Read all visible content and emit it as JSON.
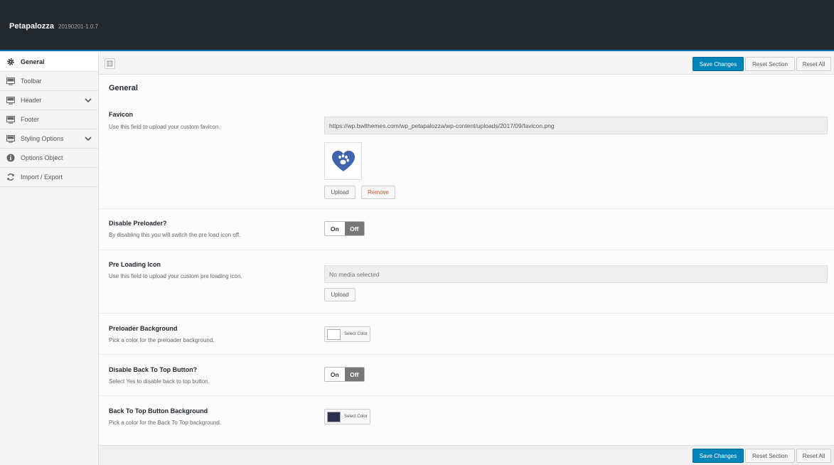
{
  "header": {
    "title": "Petapalozza",
    "version": "20190201-1.0.7"
  },
  "sidebar": {
    "items": [
      {
        "label": "General",
        "icon": "gear-icon"
      },
      {
        "label": "Toolbar",
        "icon": "monitor-icon"
      },
      {
        "label": "Header",
        "icon": "monitor-icon"
      },
      {
        "label": "Footer",
        "icon": "monitor-icon"
      },
      {
        "label": "Styling Options",
        "icon": "monitor-icon"
      },
      {
        "label": "Options Object",
        "icon": "info-icon"
      },
      {
        "label": "Import / Export",
        "icon": "refresh-icon"
      }
    ]
  },
  "buttons": {
    "save": "Save Changes",
    "reset_section": "Reset Section",
    "reset_all": "Reset All"
  },
  "section": {
    "title": "General"
  },
  "fields": {
    "favicon": {
      "label": "Favicon",
      "desc": "Use this field to upload your custom favicon.",
      "value": "https://wp.bwlthemes.com/wp_petapalozza/wp-content/uploads/2017/09/favicon.png",
      "upload": "Upload",
      "remove": "Remove"
    },
    "preloader": {
      "label": "Disable Preloader?",
      "desc": "By disabling this you will switch the pre load icon off.",
      "on": "On",
      "off": "Off"
    },
    "preicon": {
      "label": "Pre Loading Icon",
      "desc": "Use this field to upload your custom pre loading icon.",
      "placeholder": "No media selected",
      "upload": "Upload"
    },
    "prebg": {
      "label": "Preloader Background",
      "desc": "Pick a color for the preloader background.",
      "select": "Select Color",
      "color": "#ffffff"
    },
    "backtop": {
      "label": "Disable Back To Top Button?",
      "desc": "Select Yes to disable back to top button.",
      "on": "On",
      "off": "Off"
    },
    "backtopbg": {
      "label": "Back To Top Button Background",
      "desc": "Pick a color for the Back To Top background.",
      "select": "Select Color",
      "color": "#2b3151"
    }
  },
  "colors": {
    "accent": "#0085ba",
    "topbar": "#23282d",
    "favicon_blue": "#3f63ad"
  }
}
